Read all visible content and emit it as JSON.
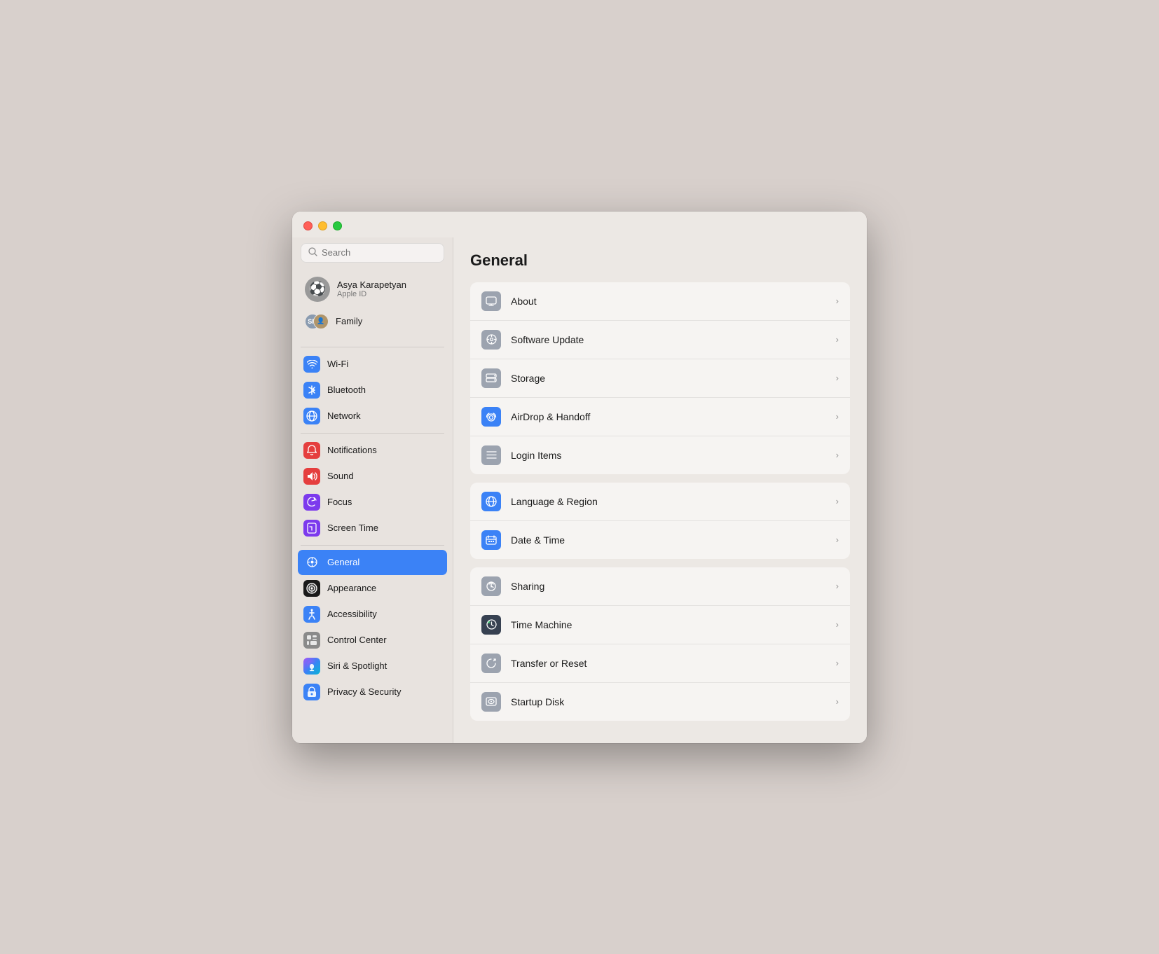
{
  "window": {
    "title": "General"
  },
  "titlebar": {
    "close_label": "",
    "min_label": "",
    "max_label": ""
  },
  "sidebar": {
    "search_placeholder": "Search",
    "user": {
      "name": "Asya Karapetyan",
      "subtitle": "Apple ID",
      "avatar_emoji": "⚽"
    },
    "family": {
      "label": "Family",
      "av1_initials": "SM",
      "av2_emoji": "👤"
    },
    "groups": [
      {
        "items": [
          {
            "id": "wifi",
            "label": "Wi-Fi",
            "icon_class": "icon-wifi",
            "icon_char": "📶"
          },
          {
            "id": "bluetooth",
            "label": "Bluetooth",
            "icon_class": "icon-bluetooth",
            "icon_char": "✦"
          },
          {
            "id": "network",
            "label": "Network",
            "icon_class": "icon-network",
            "icon_char": "🌐"
          }
        ]
      },
      {
        "items": [
          {
            "id": "notif",
            "label": "Notifications",
            "icon_class": "icon-notif",
            "icon_char": "🔔"
          },
          {
            "id": "sound",
            "label": "Sound",
            "icon_class": "icon-sound",
            "icon_char": "🔊"
          },
          {
            "id": "focus",
            "label": "Focus",
            "icon_class": "icon-focus",
            "icon_char": "🌙"
          },
          {
            "id": "screentime",
            "label": "Screen Time",
            "icon_class": "icon-screentime",
            "icon_char": "⏳"
          }
        ]
      },
      {
        "items": [
          {
            "id": "general",
            "label": "General",
            "icon_class": "icon-general",
            "icon_char": "⚙",
            "active": true
          },
          {
            "id": "appearance",
            "label": "Appearance",
            "icon_class": "icon-appearance",
            "icon_char": "◉"
          },
          {
            "id": "access",
            "label": "Accessibility",
            "icon_class": "icon-access",
            "icon_char": "♿"
          },
          {
            "id": "control",
            "label": "Control Center",
            "icon_class": "icon-control",
            "icon_char": "▦"
          },
          {
            "id": "siri",
            "label": "Siri & Spotlight",
            "icon_class": "icon-siri",
            "icon_char": "🎙"
          },
          {
            "id": "privacy",
            "label": "Privacy & Security",
            "icon_class": "icon-privacy",
            "icon_char": "✋"
          }
        ]
      }
    ]
  },
  "main": {
    "title": "General",
    "groups": [
      {
        "rows": [
          {
            "id": "about",
            "label": "About",
            "icon_class": "gray"
          },
          {
            "id": "software",
            "label": "Software Update",
            "icon_class": "gray"
          },
          {
            "id": "storage",
            "label": "Storage",
            "icon_class": "gray"
          },
          {
            "id": "airdrop",
            "label": "AirDrop & Handoff",
            "icon_class": "blue"
          },
          {
            "id": "login",
            "label": "Login Items",
            "icon_class": "gray"
          }
        ]
      },
      {
        "rows": [
          {
            "id": "language",
            "label": "Language & Region",
            "icon_class": "blue"
          },
          {
            "id": "datetime",
            "label": "Date & Time",
            "icon_class": "blue"
          }
        ]
      },
      {
        "rows": [
          {
            "id": "sharing",
            "label": "Sharing",
            "icon_class": "gray"
          },
          {
            "id": "timemachine",
            "label": "Time Machine",
            "icon_class": "dark"
          },
          {
            "id": "transfer",
            "label": "Transfer or Reset",
            "icon_class": "gray"
          },
          {
            "id": "startup",
            "label": "Startup Disk",
            "icon_class": "gray"
          }
        ]
      }
    ],
    "row_icons": {
      "about": "🖥",
      "software": "⚙",
      "storage": "🗄",
      "airdrop": "📡",
      "login": "☰",
      "language": "🌐",
      "datetime": "⌨",
      "sharing": "♲",
      "timemachine": "⏱",
      "transfer": "↺",
      "startup": "💾"
    }
  }
}
